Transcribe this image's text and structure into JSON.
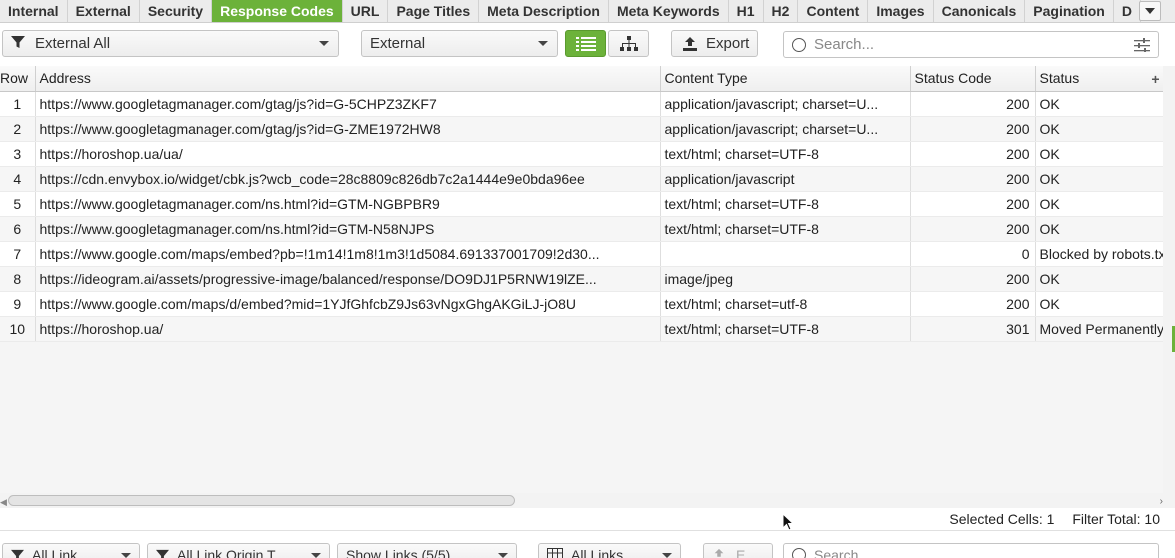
{
  "tabs": [
    {
      "label": "Internal",
      "active": false
    },
    {
      "label": "External",
      "active": false
    },
    {
      "label": "Security",
      "active": false
    },
    {
      "label": "Response Codes",
      "active": true
    },
    {
      "label": "URL",
      "active": false
    },
    {
      "label": "Page Titles",
      "active": false
    },
    {
      "label": "Meta Description",
      "active": false
    },
    {
      "label": "Meta Keywords",
      "active": false
    },
    {
      "label": "H1",
      "active": false
    },
    {
      "label": "H2",
      "active": false
    },
    {
      "label": "Content",
      "active": false
    },
    {
      "label": "Images",
      "active": false
    },
    {
      "label": "Canonicals",
      "active": false
    },
    {
      "label": "Pagination",
      "active": false
    },
    {
      "label": "D",
      "active": false
    }
  ],
  "toolbar": {
    "filter_value": "External All",
    "scope_value": "External",
    "export_label": "Export",
    "search_placeholder": "Search..."
  },
  "table": {
    "columns": [
      "Row",
      "Address",
      "Content Type",
      "Status Code",
      "Status"
    ],
    "rows": [
      {
        "row": "1",
        "address": "https://www.googletagmanager.com/gtag/js?id=G-5CHPZ3ZKF7",
        "content_type": "application/javascript; charset=U...",
        "status_code": "200",
        "status": "OK"
      },
      {
        "row": "2",
        "address": "https://www.googletagmanager.com/gtag/js?id=G-ZME1972HW8",
        "content_type": "application/javascript; charset=U...",
        "status_code": "200",
        "status": "OK"
      },
      {
        "row": "3",
        "address": "https://horoshop.ua/ua/",
        "content_type": "text/html; charset=UTF-8",
        "status_code": "200",
        "status": "OK"
      },
      {
        "row": "4",
        "address": "https://cdn.envybox.io/widget/cbk.js?wcb_code=28c8809c826db7c2a1444e9e0bda96ee",
        "content_type": "application/javascript",
        "status_code": "200",
        "status": "OK"
      },
      {
        "row": "5",
        "address": "https://www.googletagmanager.com/ns.html?id=GTM-NGBPBR9",
        "content_type": "text/html; charset=UTF-8",
        "status_code": "200",
        "status": "OK"
      },
      {
        "row": "6",
        "address": "https://www.googletagmanager.com/ns.html?id=GTM-N58NJPS",
        "content_type": "text/html; charset=UTF-8",
        "status_code": "200",
        "status": "OK"
      },
      {
        "row": "7",
        "address": "https://www.google.com/maps/embed?pb=!1m14!1m8!1m3!1d5084.691337001709!2d30...",
        "content_type": "",
        "status_code": "0",
        "status": "Blocked by robots.txt"
      },
      {
        "row": "8",
        "address": "https://ideogram.ai/assets/progressive-image/balanced/response/DO9DJ1P5RNW19lZE...",
        "content_type": "image/jpeg",
        "status_code": "200",
        "status": "OK"
      },
      {
        "row": "9",
        "address": "https://www.google.com/maps/d/embed?mid=1YJfGhfcbZ9Js63vNgxGhgAKGiLJ-jO8U",
        "content_type": "text/html; charset=utf-8",
        "status_code": "200",
        "status": "OK"
      },
      {
        "row": "10",
        "address": "https://horoshop.ua/",
        "content_type": "text/html; charset=UTF-8",
        "status_code": "301",
        "status": "Moved Permanently"
      }
    ]
  },
  "status_bar": {
    "selected_cells": "Selected Cells:  1",
    "filter_total": "Filter Total:  10"
  },
  "bottom_toolbar": {
    "type_filter": "All Link",
    "origin_filter": "All Link Origin T",
    "show_links": "Show Links (5/5)",
    "links_view": "All Links",
    "export_label": "E",
    "search_placeholder": "Search..."
  },
  "colors": {
    "accent": "#6cb23a"
  }
}
